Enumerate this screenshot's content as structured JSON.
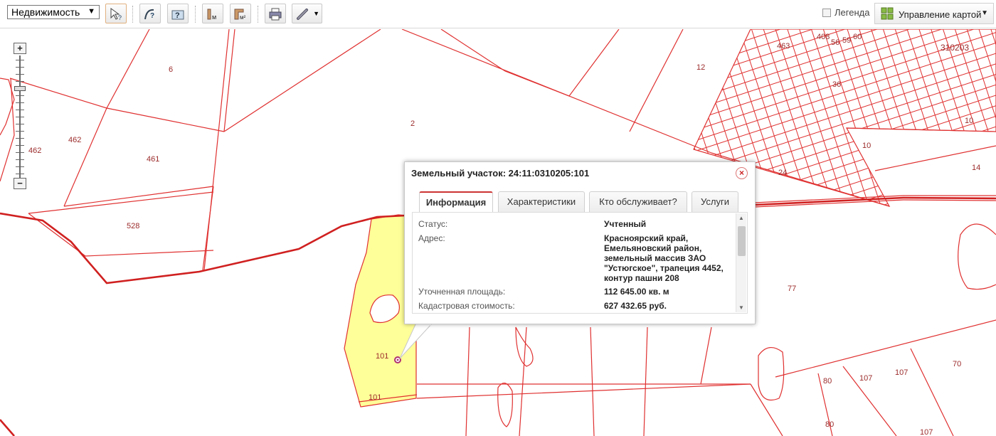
{
  "toolbar": {
    "layer_select": "Недвижимость",
    "legend_label": "Легенда",
    "map_control_label": "Управление картой"
  },
  "map": {
    "parcel_labels": [
      "6",
      "462",
      "462",
      "461",
      "528",
      "2",
      "12",
      "463",
      "408",
      "56",
      "59",
      "60",
      "310203",
      "36",
      "10",
      "10",
      "14",
      "24",
      "77",
      "101",
      "101",
      "80",
      "80",
      "107",
      "107",
      "107",
      "70"
    ]
  },
  "zoom": {
    "plus": "+",
    "minus": "−"
  },
  "popup": {
    "title": "Земельный участок: 24:11:0310205:101",
    "close": "×",
    "tabs": [
      "Информация",
      "Характеристики",
      "Кто обслуживает?",
      "Услуги"
    ],
    "fields": [
      {
        "label": "Статус:",
        "value": "Учтенный"
      },
      {
        "label": "Адрес:",
        "value": "Красноярский край, Емельяновский район, земельный массив ЗАО \"Устюгское\", трапеция 4452, контур пашни 208"
      },
      {
        "label": "Уточненная площадь:",
        "value": "112 645.00 кв. м"
      },
      {
        "label": "Кадастровая стоимость:",
        "value": "627 432.65 руб."
      }
    ]
  },
  "colors": {
    "parcel_line": "#e03030",
    "selected_fill": "#ffff99",
    "boundary": "#d02020"
  }
}
